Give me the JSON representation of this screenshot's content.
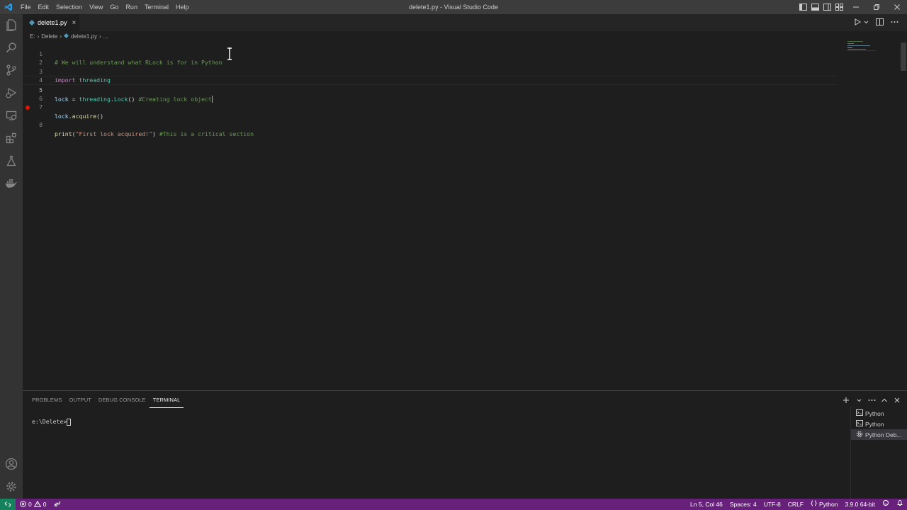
{
  "window": {
    "title": "delete1.py - Visual Studio Code"
  },
  "menu": [
    "File",
    "Edit",
    "Selection",
    "View",
    "Go",
    "Run",
    "Terminal",
    "Help"
  ],
  "tab": {
    "label": "delete1.py",
    "close": "×"
  },
  "breadcrumb": [
    "E:",
    "Delete",
    "delete1.py",
    "..."
  ],
  "editor": {
    "line_numbers": [
      "1",
      "2",
      "3",
      "4",
      "5",
      "6",
      "7",
      "8"
    ],
    "line1_comment": "# We will understand what RLock is for in Python",
    "line3_kw": "import",
    "line3_mod": "threading",
    "line5_var": "lock",
    "line5_eq": " = ",
    "line5_mod": "threading",
    "line5_dot": ".",
    "line5_cls": "Lock",
    "line5_paren": "() ",
    "line5_comment": "#Creating lock object",
    "line7_var": "lock",
    "line7_dot": ".",
    "line7_func": "acquire",
    "line7_paren": "()",
    "line8_func": "print",
    "line8_open": "(",
    "line8_string": "\"First lock acquired!\"",
    "line8_close": ") ",
    "line8_comment": "#This is a critical section"
  },
  "panel": {
    "tabs": [
      "PROBLEMS",
      "OUTPUT",
      "DEBUG CONSOLE",
      "TERMINAL"
    ],
    "active_tab": "TERMINAL",
    "terminal_prompt": "e:\\Delete>",
    "terminals": [
      "Python",
      "Python",
      "Python Deb..."
    ]
  },
  "statusbar": {
    "errors": "0",
    "warnings": "0",
    "position": "Ln 5, Col 46",
    "spaces": "Spaces: 4",
    "encoding": "UTF-8",
    "eol": "CRLF",
    "language": "Python",
    "interpreter": "3.9.0 64-bit"
  },
  "colors": {
    "statusbar": "#68217a",
    "remote": "#16825d",
    "titlebar": "#3c3c3c",
    "activitybar": "#333333",
    "editor_bg": "#1e1e1e",
    "breakpoint": "#e51400"
  },
  "icons": {
    "activity": [
      "explorer-icon",
      "search-icon",
      "source-control-icon",
      "run-debug-icon",
      "remote-explorer-icon",
      "extensions-icon",
      "testing-icon",
      "docker-icon",
      "account-icon",
      "settings-gear-icon"
    ]
  }
}
